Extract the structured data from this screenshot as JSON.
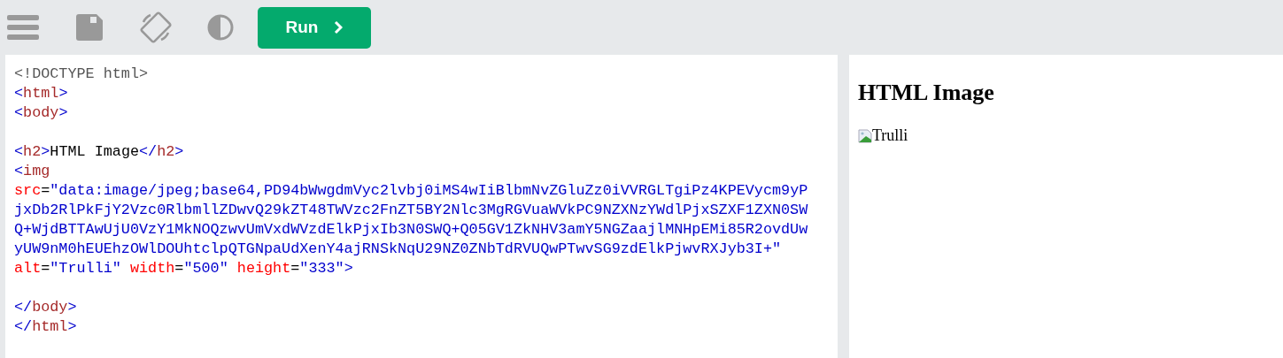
{
  "toolbar": {
    "run_button": {
      "label": "Run"
    }
  },
  "editor": {
    "lines": [
      {
        "kind": "code",
        "tokens": [
          {
            "kind": "doctype",
            "text": "<!DOCTYPE html>"
          }
        ]
      },
      {
        "kind": "code",
        "tokens": [
          {
            "kind": "bracket",
            "text": "<"
          },
          {
            "kind": "tag",
            "text": "html"
          },
          {
            "kind": "bracket",
            "text": ">"
          }
        ]
      },
      {
        "kind": "code",
        "tokens": [
          {
            "kind": "bracket",
            "text": "<"
          },
          {
            "kind": "tag",
            "text": "body"
          },
          {
            "kind": "bracket",
            "text": ">"
          }
        ]
      },
      {
        "kind": "blank"
      },
      {
        "kind": "code",
        "tokens": [
          {
            "kind": "bracket",
            "text": "<"
          },
          {
            "kind": "tag",
            "text": "h2"
          },
          {
            "kind": "bracket",
            "text": ">"
          },
          {
            "kind": "text",
            "text": "HTML Image"
          },
          {
            "kind": "bracket",
            "text": "</"
          },
          {
            "kind": "tag",
            "text": "h2"
          },
          {
            "kind": "bracket",
            "text": ">"
          }
        ]
      },
      {
        "kind": "code",
        "tokens": [
          {
            "kind": "bracket",
            "text": "<"
          },
          {
            "kind": "tag",
            "text": "img"
          }
        ]
      },
      {
        "kind": "code",
        "tokens": [
          {
            "kind": "attr",
            "text": "src"
          },
          {
            "kind": "text",
            "text": "="
          },
          {
            "kind": "string",
            "text": "\"data:image/jpeg;base64,PD94bWwgdmVyc2lvbj0iMS4wIiBlbmNvZGluZz0iVVRGLTgiPz4KPEVycm9yP"
          }
        ]
      },
      {
        "kind": "code",
        "tokens": [
          {
            "kind": "string",
            "text": "jxDb2RlPkFjY2Vzc0RlbmllZDwvQ29kZT48TWVzc2FnZT5BY2Nlc3MgRGVuaWVkPC9NZXNzYWdlPjxSZXF1ZXN0SW"
          }
        ]
      },
      {
        "kind": "code",
        "tokens": [
          {
            "kind": "string",
            "text": "Q+WjdBTTAwUjU0VzY1MkNOQzwvUmVxdWVzdElkPjxIb3N0SWQ+Q05GV1ZkNHV3amY5NGZaajlMNHpEMi85R2ovdUw"
          }
        ]
      },
      {
        "kind": "code",
        "tokens": [
          {
            "kind": "string",
            "text": "yUW9nM0hEUEhzOWlDOUhtclpQTGNpaUdXenY4ajRNSkNqU29NZ0ZNbTdRVUQwPTwvSG9zdElkPjwvRXJyb3I+\""
          }
        ]
      },
      {
        "kind": "code",
        "tokens": [
          {
            "kind": "attr",
            "text": "alt"
          },
          {
            "kind": "text",
            "text": "="
          },
          {
            "kind": "string",
            "text": "\"Trulli\" "
          },
          {
            "kind": "attr",
            "text": "width"
          },
          {
            "kind": "text",
            "text": "="
          },
          {
            "kind": "string",
            "text": "\"500\" "
          },
          {
            "kind": "attr",
            "text": "height"
          },
          {
            "kind": "text",
            "text": "="
          },
          {
            "kind": "string",
            "text": "\"333\""
          },
          {
            "kind": "bracket",
            "text": ">"
          }
        ]
      },
      {
        "kind": "blank"
      },
      {
        "kind": "code",
        "tokens": [
          {
            "kind": "bracket",
            "text": "</"
          },
          {
            "kind": "tag",
            "text": "body"
          },
          {
            "kind": "bracket",
            "text": ">"
          }
        ]
      },
      {
        "kind": "code",
        "tokens": [
          {
            "kind": "bracket",
            "text": "</"
          },
          {
            "kind": "tag",
            "text": "html"
          },
          {
            "kind": "bracket",
            "text": ">"
          }
        ]
      }
    ]
  },
  "preview": {
    "heading": "HTML Image",
    "image": {
      "alt": "Trulli"
    }
  }
}
